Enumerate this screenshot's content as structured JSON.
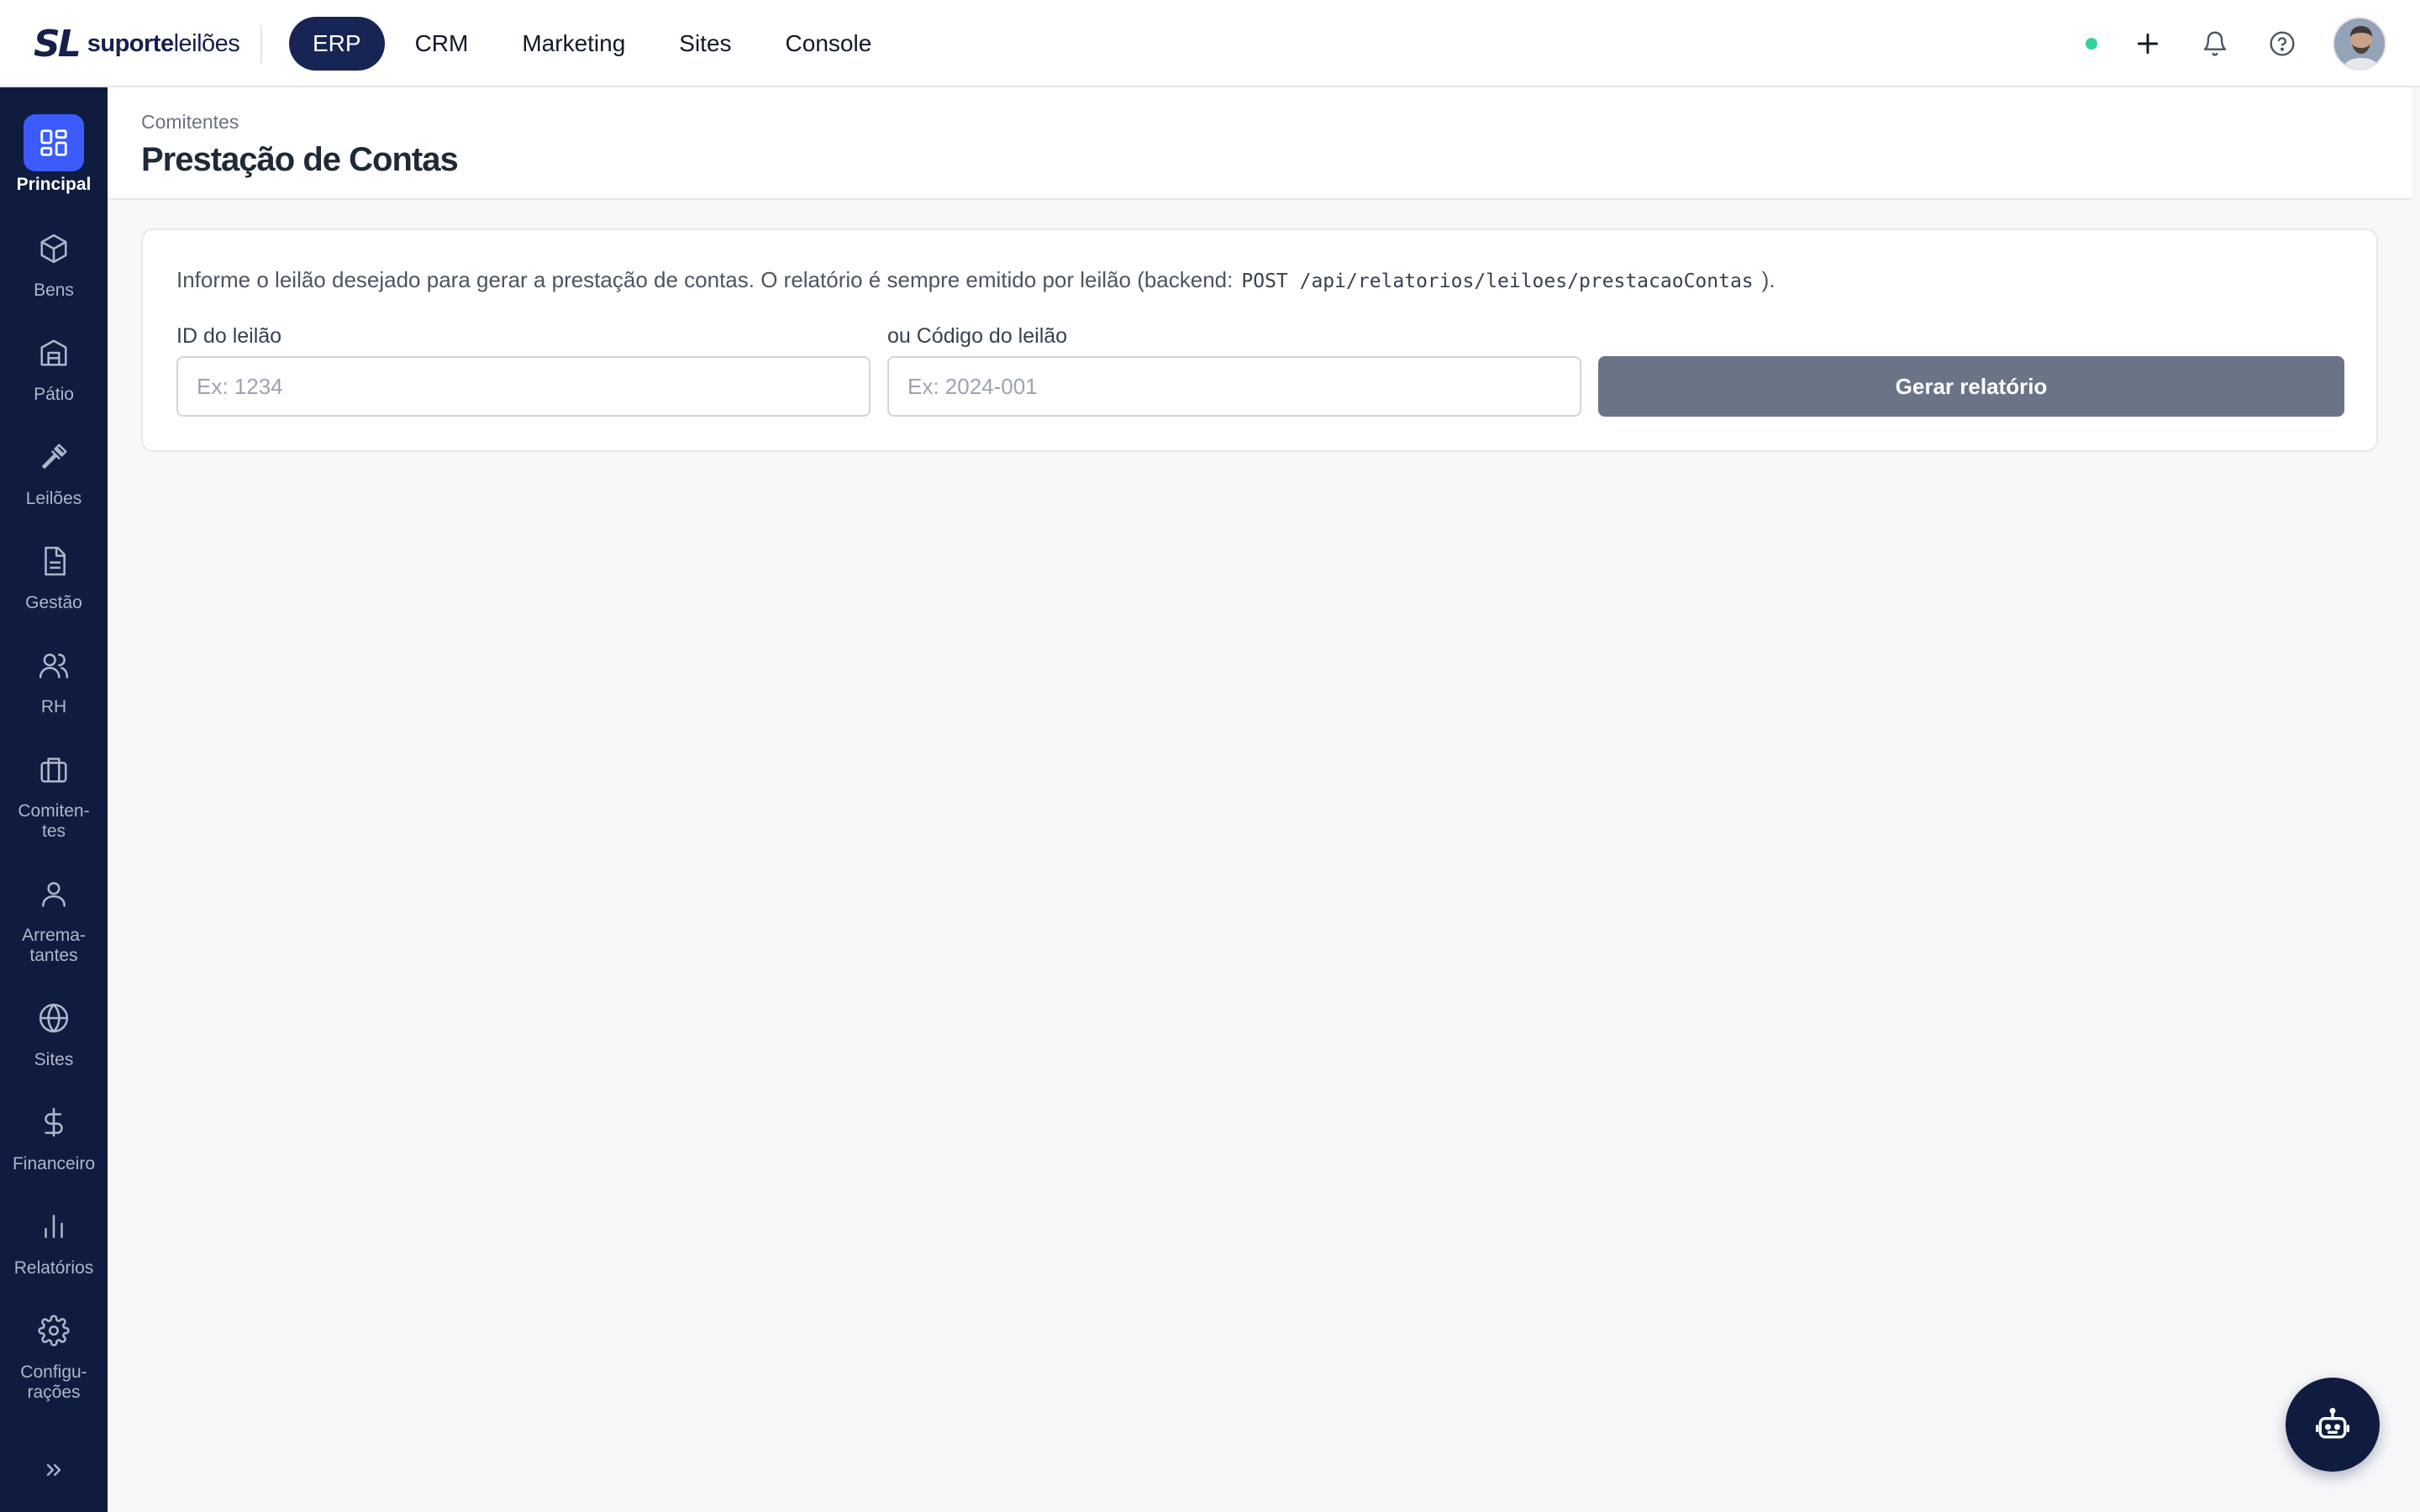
{
  "brand": {
    "mark": "SL",
    "name_bold": "suporte",
    "name_light": "leilões"
  },
  "topnav": [
    {
      "label": "ERP",
      "active": true
    },
    {
      "label": "CRM",
      "active": false
    },
    {
      "label": "Marketing",
      "active": false
    },
    {
      "label": "Sites",
      "active": false
    },
    {
      "label": "Console",
      "active": false
    }
  ],
  "sidebar": {
    "items": [
      {
        "label": "Principal",
        "icon": "dashboard-icon",
        "active": true
      },
      {
        "label": "Bens",
        "icon": "box-icon"
      },
      {
        "label": "Pátio",
        "icon": "warehouse-icon"
      },
      {
        "label": "Leilões",
        "icon": "gavel-icon"
      },
      {
        "label": "Gestão",
        "icon": "document-icon"
      },
      {
        "label": "RH",
        "icon": "users-icon"
      },
      {
        "label": "Comiten-\ntes",
        "icon": "briefcase-icon"
      },
      {
        "label": "Arrema-\ntantes",
        "icon": "user-icon"
      },
      {
        "label": "Sites",
        "icon": "globe-icon"
      },
      {
        "label": "Financeiro",
        "icon": "dollar-icon"
      },
      {
        "label": "Relatórios",
        "icon": "bar-chart-icon"
      },
      {
        "label": "Configu-\nrações",
        "icon": "gear-icon"
      }
    ]
  },
  "header": {
    "breadcrumb": "Comitentes",
    "title": "Prestação de Contas"
  },
  "form": {
    "info_prefix": "Informe o leilão desejado para gerar a prestação de contas. O relatório é sempre emitido por leilão (backend:",
    "info_code": "POST /api/relatorios/leiloes/prestacaoContas",
    "info_suffix": ").",
    "id_label": "ID do leilão",
    "id_placeholder": "Ex: 1234",
    "id_value": "",
    "code_label": "ou Código do leilão",
    "code_placeholder": "Ex: 2024-001",
    "code_value": "",
    "submit_label": "Gerar relatório"
  },
  "colors": {
    "nav_active": "#172554",
    "sidebar_bg": "#0f1c3f",
    "sidebar_active": "#3b5bfd",
    "button_disabled": "#6b7387",
    "status_online": "#34d399"
  }
}
